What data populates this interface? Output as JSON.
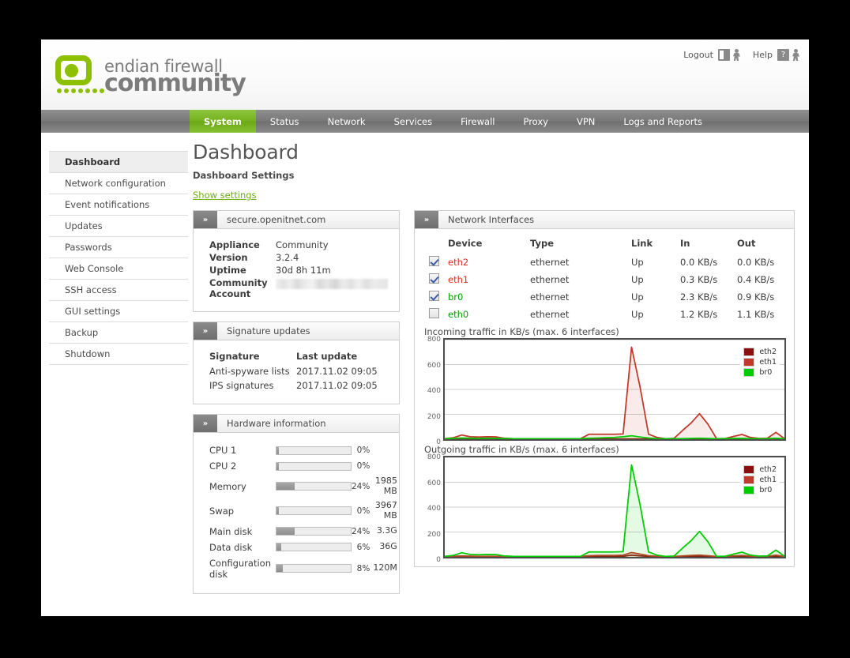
{
  "header": {
    "logout_label": "Logout",
    "help_label": "Help",
    "logo_line1": "endian firewall",
    "logo_line2": "community"
  },
  "nav": {
    "items": [
      {
        "label": "System",
        "active": true
      },
      {
        "label": "Status",
        "active": false
      },
      {
        "label": "Network",
        "active": false
      },
      {
        "label": "Services",
        "active": false
      },
      {
        "label": "Firewall",
        "active": false
      },
      {
        "label": "Proxy",
        "active": false
      },
      {
        "label": "VPN",
        "active": false
      },
      {
        "label": "Logs and Reports",
        "active": false
      }
    ]
  },
  "sidebar": {
    "items": [
      {
        "label": "Dashboard",
        "active": true
      },
      {
        "label": "Network configuration",
        "active": false
      },
      {
        "label": "Event notifications",
        "active": false
      },
      {
        "label": "Updates",
        "active": false
      },
      {
        "label": "Passwords",
        "active": false
      },
      {
        "label": "Web Console",
        "active": false
      },
      {
        "label": "SSH access",
        "active": false
      },
      {
        "label": "GUI settings",
        "active": false
      },
      {
        "label": "Backup",
        "active": false
      },
      {
        "label": "Shutdown",
        "active": false
      }
    ]
  },
  "main": {
    "title": "Dashboard",
    "subtitle": "Dashboard Settings",
    "show_settings_label": "Show settings"
  },
  "system_panel": {
    "title": "secure.openitnet.com",
    "chevron": "»",
    "rows": [
      {
        "key": "Appliance",
        "value": "Community"
      },
      {
        "key": "Version",
        "value": "3.2.4"
      },
      {
        "key": "Uptime",
        "value": "30d 8h 11m"
      },
      {
        "key": "Community Account",
        "value": ""
      }
    ]
  },
  "signature_panel": {
    "title": "Signature updates",
    "chevron": "»",
    "headers": [
      "Signature",
      "Last update"
    ],
    "rows": [
      {
        "name": "Anti-spyware lists",
        "updated": "2017.11.02 09:05"
      },
      {
        "name": "IPS signatures",
        "updated": "2017.11.02 09:05"
      }
    ]
  },
  "hardware_panel": {
    "title": "Hardware information",
    "chevron": "»",
    "rows": [
      {
        "label": "CPU 1",
        "percent": 0,
        "percent_label": "0%",
        "size": ""
      },
      {
        "label": "CPU 2",
        "percent": 0,
        "percent_label": "0%",
        "size": ""
      },
      {
        "label": "Memory",
        "percent": 24,
        "percent_label": "24%",
        "size": "1985 MB"
      },
      {
        "label": "Swap",
        "percent": 0,
        "percent_label": "0%",
        "size": "3967 MB"
      },
      {
        "label": "Main disk",
        "percent": 24,
        "percent_label": "24%",
        "size": "3.3G"
      },
      {
        "label": "Data disk",
        "percent": 6,
        "percent_label": "6%",
        "size": "36G"
      },
      {
        "label": "Configuration disk",
        "percent": 8,
        "percent_label": "8%",
        "size": "120M"
      }
    ]
  },
  "network_panel": {
    "title": "Network Interfaces",
    "chevron": "»",
    "headers": [
      "",
      "Device",
      "Type",
      "Link",
      "In",
      "Out"
    ],
    "rows": [
      {
        "checked": true,
        "device": "eth2",
        "device_color": "#e02b20",
        "type": "ethernet",
        "link": "Up",
        "in": "0.0 KB/s",
        "out": "0.0 KB/s"
      },
      {
        "checked": true,
        "device": "eth1",
        "device_color": "#e02b20",
        "type": "ethernet",
        "link": "Up",
        "in": "0.3 KB/s",
        "out": "0.4 KB/s"
      },
      {
        "checked": true,
        "device": "br0",
        "device_color": "#00a000",
        "type": "ethernet",
        "link": "Up",
        "in": "2.3 KB/s",
        "out": "0.9 KB/s"
      },
      {
        "checked": false,
        "device": "eth0",
        "device_color": "#00a000",
        "type": "ethernet",
        "link": "Up",
        "in": "1.2 KB/s",
        "out": "1.1 KB/s"
      }
    ]
  },
  "colors": {
    "brand_green": "#8cc000",
    "nav_active": "#74b01b",
    "link_green": "#6eae15",
    "eth2": "#8b0f0f",
    "eth1": "#c0392b",
    "br0": "#00cc00"
  },
  "chart_data": [
    {
      "type": "line",
      "title": "Incoming traffic in KB/s (max. 6 interfaces)",
      "xlabel": "",
      "ylabel": "",
      "ylim": [
        0,
        800
      ],
      "yticks": [
        0,
        200,
        400,
        600,
        800
      ],
      "grid": true,
      "legend_position": "top-right",
      "x": [
        0,
        1,
        2,
        3,
        4,
        5,
        6,
        7,
        8,
        9,
        10,
        11,
        12,
        13,
        14,
        15,
        16,
        17,
        18,
        19,
        20,
        21,
        22,
        23,
        24,
        25,
        26,
        27,
        28,
        29,
        30,
        31,
        32,
        33,
        34,
        35,
        36,
        37,
        38,
        39,
        40
      ],
      "series": [
        {
          "name": "eth2",
          "color": "#8b0f0f",
          "values": [
            1,
            1,
            1,
            1,
            1,
            1,
            1,
            1,
            1,
            1,
            1,
            1,
            1,
            1,
            1,
            1,
            1,
            1,
            1,
            1,
            1,
            1,
            1,
            1,
            1,
            1,
            1,
            1,
            1,
            1,
            1,
            1,
            1,
            1,
            1,
            1,
            1,
            1,
            1,
            1,
            1
          ]
        },
        {
          "name": "eth1",
          "color": "#c0392b",
          "values": [
            5,
            12,
            34,
            20,
            17,
            20,
            19,
            8,
            5,
            4,
            4,
            4,
            4,
            4,
            4,
            4,
            4,
            40,
            40,
            40,
            40,
            42,
            740,
            420,
            40,
            14,
            4,
            7,
            70,
            130,
            205,
            120,
            5,
            5,
            22,
            38,
            14,
            6,
            8,
            55,
            5
          ]
        },
        {
          "name": "br0",
          "color": "#00cc00",
          "values": [
            4,
            7,
            10,
            8,
            7,
            7,
            7,
            5,
            4,
            4,
            4,
            4,
            4,
            4,
            4,
            4,
            4,
            8,
            10,
            12,
            14,
            20,
            28,
            18,
            10,
            5,
            4,
            4,
            5,
            6,
            8,
            6,
            4,
            5,
            6,
            7,
            5,
            4,
            5,
            8,
            4
          ]
        }
      ]
    },
    {
      "type": "line",
      "title": "Outgoing traffic in KB/s (max. 6 interfaces)",
      "xlabel": "",
      "ylabel": "",
      "ylim": [
        0,
        800
      ],
      "yticks": [
        0,
        200,
        400,
        600,
        800
      ],
      "grid": true,
      "legend_position": "top-right",
      "x": [
        0,
        1,
        2,
        3,
        4,
        5,
        6,
        7,
        8,
        9,
        10,
        11,
        12,
        13,
        14,
        15,
        16,
        17,
        18,
        19,
        20,
        21,
        22,
        23,
        24,
        25,
        26,
        27,
        28,
        29,
        30,
        31,
        32,
        33,
        34,
        35,
        36,
        37,
        38,
        39,
        40
      ],
      "series": [
        {
          "name": "eth2",
          "color": "#8b0f0f",
          "values": [
            2,
            2,
            2,
            2,
            2,
            2,
            2,
            2,
            2,
            2,
            2,
            2,
            2,
            2,
            2,
            2,
            2,
            4,
            4,
            4,
            4,
            4,
            14,
            8,
            4,
            2,
            2,
            2,
            4,
            5,
            6,
            4,
            2,
            2,
            3,
            4,
            3,
            2,
            2,
            4,
            2
          ]
        },
        {
          "name": "eth1",
          "color": "#c0392b",
          "values": [
            3,
            5,
            8,
            6,
            5,
            5,
            5,
            4,
            3,
            3,
            3,
            3,
            3,
            3,
            3,
            3,
            3,
            10,
            12,
            12,
            12,
            14,
            35,
            22,
            10,
            5,
            3,
            3,
            8,
            12,
            14,
            10,
            3,
            4,
            8,
            12,
            6,
            3,
            4,
            14,
            3
          ]
        },
        {
          "name": "br0",
          "color": "#00cc00",
          "values": [
            5,
            12,
            34,
            20,
            17,
            20,
            19,
            8,
            5,
            4,
            4,
            4,
            4,
            4,
            4,
            4,
            4,
            40,
            40,
            40,
            40,
            42,
            740,
            420,
            40,
            14,
            4,
            7,
            70,
            130,
            205,
            120,
            5,
            5,
            22,
            38,
            14,
            6,
            8,
            55,
            5
          ]
        }
      ]
    }
  ]
}
